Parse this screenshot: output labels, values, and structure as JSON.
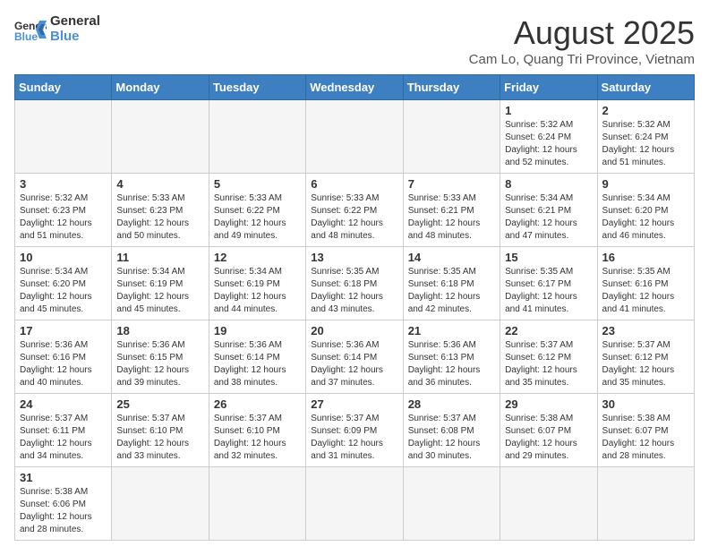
{
  "header": {
    "logo_general": "General",
    "logo_blue": "Blue",
    "title": "August 2025",
    "subtitle": "Cam Lo, Quang Tri Province, Vietnam"
  },
  "days_of_week": [
    "Sunday",
    "Monday",
    "Tuesday",
    "Wednesday",
    "Thursday",
    "Friday",
    "Saturday"
  ],
  "weeks": [
    [
      {
        "date": "",
        "info": ""
      },
      {
        "date": "",
        "info": ""
      },
      {
        "date": "",
        "info": ""
      },
      {
        "date": "",
        "info": ""
      },
      {
        "date": "",
        "info": ""
      },
      {
        "date": "1",
        "info": "Sunrise: 5:32 AM\nSunset: 6:24 PM\nDaylight: 12 hours and 52 minutes."
      },
      {
        "date": "2",
        "info": "Sunrise: 5:32 AM\nSunset: 6:24 PM\nDaylight: 12 hours and 51 minutes."
      }
    ],
    [
      {
        "date": "3",
        "info": "Sunrise: 5:32 AM\nSunset: 6:23 PM\nDaylight: 12 hours and 51 minutes."
      },
      {
        "date": "4",
        "info": "Sunrise: 5:33 AM\nSunset: 6:23 PM\nDaylight: 12 hours and 50 minutes."
      },
      {
        "date": "5",
        "info": "Sunrise: 5:33 AM\nSunset: 6:22 PM\nDaylight: 12 hours and 49 minutes."
      },
      {
        "date": "6",
        "info": "Sunrise: 5:33 AM\nSunset: 6:22 PM\nDaylight: 12 hours and 48 minutes."
      },
      {
        "date": "7",
        "info": "Sunrise: 5:33 AM\nSunset: 6:21 PM\nDaylight: 12 hours and 48 minutes."
      },
      {
        "date": "8",
        "info": "Sunrise: 5:34 AM\nSunset: 6:21 PM\nDaylight: 12 hours and 47 minutes."
      },
      {
        "date": "9",
        "info": "Sunrise: 5:34 AM\nSunset: 6:20 PM\nDaylight: 12 hours and 46 minutes."
      }
    ],
    [
      {
        "date": "10",
        "info": "Sunrise: 5:34 AM\nSunset: 6:20 PM\nDaylight: 12 hours and 45 minutes."
      },
      {
        "date": "11",
        "info": "Sunrise: 5:34 AM\nSunset: 6:19 PM\nDaylight: 12 hours and 45 minutes."
      },
      {
        "date": "12",
        "info": "Sunrise: 5:34 AM\nSunset: 6:19 PM\nDaylight: 12 hours and 44 minutes."
      },
      {
        "date": "13",
        "info": "Sunrise: 5:35 AM\nSunset: 6:18 PM\nDaylight: 12 hours and 43 minutes."
      },
      {
        "date": "14",
        "info": "Sunrise: 5:35 AM\nSunset: 6:18 PM\nDaylight: 12 hours and 42 minutes."
      },
      {
        "date": "15",
        "info": "Sunrise: 5:35 AM\nSunset: 6:17 PM\nDaylight: 12 hours and 41 minutes."
      },
      {
        "date": "16",
        "info": "Sunrise: 5:35 AM\nSunset: 6:16 PM\nDaylight: 12 hours and 41 minutes."
      }
    ],
    [
      {
        "date": "17",
        "info": "Sunrise: 5:36 AM\nSunset: 6:16 PM\nDaylight: 12 hours and 40 minutes."
      },
      {
        "date": "18",
        "info": "Sunrise: 5:36 AM\nSunset: 6:15 PM\nDaylight: 12 hours and 39 minutes."
      },
      {
        "date": "19",
        "info": "Sunrise: 5:36 AM\nSunset: 6:14 PM\nDaylight: 12 hours and 38 minutes."
      },
      {
        "date": "20",
        "info": "Sunrise: 5:36 AM\nSunset: 6:14 PM\nDaylight: 12 hours and 37 minutes."
      },
      {
        "date": "21",
        "info": "Sunrise: 5:36 AM\nSunset: 6:13 PM\nDaylight: 12 hours and 36 minutes."
      },
      {
        "date": "22",
        "info": "Sunrise: 5:37 AM\nSunset: 6:12 PM\nDaylight: 12 hours and 35 minutes."
      },
      {
        "date": "23",
        "info": "Sunrise: 5:37 AM\nSunset: 6:12 PM\nDaylight: 12 hours and 35 minutes."
      }
    ],
    [
      {
        "date": "24",
        "info": "Sunrise: 5:37 AM\nSunset: 6:11 PM\nDaylight: 12 hours and 34 minutes."
      },
      {
        "date": "25",
        "info": "Sunrise: 5:37 AM\nSunset: 6:10 PM\nDaylight: 12 hours and 33 minutes."
      },
      {
        "date": "26",
        "info": "Sunrise: 5:37 AM\nSunset: 6:10 PM\nDaylight: 12 hours and 32 minutes."
      },
      {
        "date": "27",
        "info": "Sunrise: 5:37 AM\nSunset: 6:09 PM\nDaylight: 12 hours and 31 minutes."
      },
      {
        "date": "28",
        "info": "Sunrise: 5:37 AM\nSunset: 6:08 PM\nDaylight: 12 hours and 30 minutes."
      },
      {
        "date": "29",
        "info": "Sunrise: 5:38 AM\nSunset: 6:07 PM\nDaylight: 12 hours and 29 minutes."
      },
      {
        "date": "30",
        "info": "Sunrise: 5:38 AM\nSunset: 6:07 PM\nDaylight: 12 hours and 28 minutes."
      }
    ],
    [
      {
        "date": "31",
        "info": "Sunrise: 5:38 AM\nSunset: 6:06 PM\nDaylight: 12 hours and 28 minutes."
      },
      {
        "date": "",
        "info": ""
      },
      {
        "date": "",
        "info": ""
      },
      {
        "date": "",
        "info": ""
      },
      {
        "date": "",
        "info": ""
      },
      {
        "date": "",
        "info": ""
      },
      {
        "date": "",
        "info": ""
      }
    ]
  ]
}
